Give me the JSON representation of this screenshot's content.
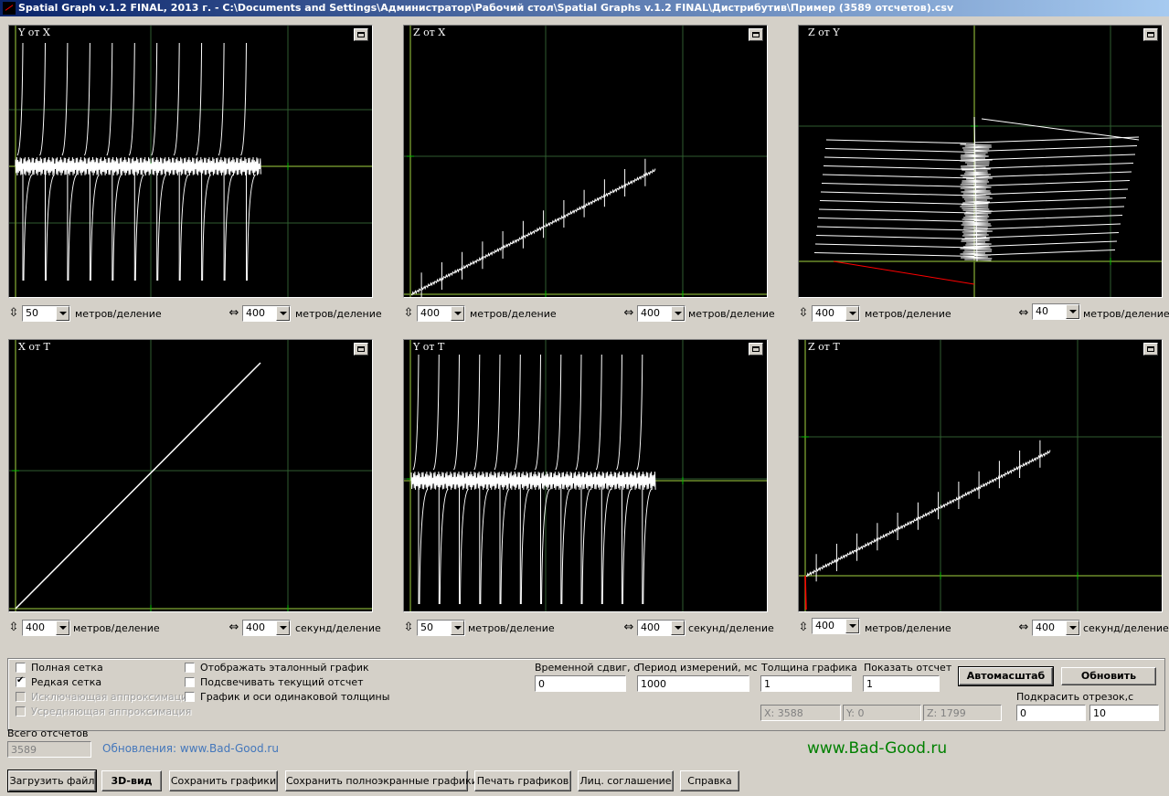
{
  "window": {
    "title": "Spatial Graph v.1.2 FINAL, 2013 г. - C:\\Documents and Settings\\Администратор\\Рабочий стол\\Spatial Graphs v.1.2 FINAL\\Дистрибутив\\Пример (3589 отсчетов).csv"
  },
  "colors": {
    "plot_bg": "#000000",
    "trace": "#ffffff",
    "grid": "#2f5d2f",
    "axis": "#6c8c2a",
    "tick": "#00c000",
    "highlight": "#ff0000"
  },
  "plots": [
    {
      "label": "Y от X",
      "v_scale": "50",
      "v_unit": "метров/деление",
      "h_scale": "400",
      "h_unit": "метров/деление"
    },
    {
      "label": "Z от X",
      "v_scale": "400",
      "v_unit": "метров/деление",
      "h_scale": "400",
      "h_unit": "метров/деление"
    },
    {
      "label": "Z от Y",
      "v_scale": "400",
      "v_unit": "метров/деление",
      "h_scale": "40",
      "h_unit": "метров/деление"
    },
    {
      "label": "X от T",
      "v_scale": "400",
      "v_unit": "метров/деление",
      "h_scale": "400",
      "h_unit": "секунд/деление"
    },
    {
      "label": "Y от T",
      "v_scale": "50",
      "v_unit": "метров/деление",
      "h_scale": "400",
      "h_unit": "секунд/деление"
    },
    {
      "label": "Z от T",
      "v_scale": "400",
      "v_unit": "метров/деление",
      "h_scale": "400",
      "h_unit": "секунд/деление"
    }
  ],
  "options": {
    "full_grid": "Полная сетка",
    "sparse_grid": "Редкая сетка",
    "exclusive_approx": "Исключающая аппроксимация",
    "averaging_approx": "Усредняющая аппроксимация",
    "show_reference": "Отображать эталонный график",
    "highlight_current": "Подсвечивать текущий отсчет",
    "same_thickness": "График и оси одинаковой толщины"
  },
  "params": {
    "time_shift_label": "Временной сдвиг, с",
    "time_shift": "0",
    "period_label": "Период измерений, мс",
    "period": "1000",
    "thickness_label": "Толщина графика",
    "thickness": "1",
    "show_sample_label": "Показать отсчет",
    "show_sample": "1",
    "x_readout": "X: 3588",
    "y_readout": "Y: 0",
    "z_readout": "Z: 1799",
    "segment_label": "Подкрасить отрезок,с",
    "segment_from": "0",
    "segment_to": "10"
  },
  "buttons": {
    "autoscale": "Автомасштаб",
    "refresh": "Обновить",
    "load": "Загрузить файл",
    "view3d": "3D-вид",
    "save": "Сохранить графики",
    "save_full": "Сохранить полноэкранные графики",
    "print": "Печать графиков",
    "license": "Лиц. соглашение",
    "help": "Справка"
  },
  "total": {
    "label": "Всего отсчетов",
    "value": "3589"
  },
  "updates_link": "Обновления: www.Bad-Good.ru",
  "site": "www.Bad-Good.ru"
}
